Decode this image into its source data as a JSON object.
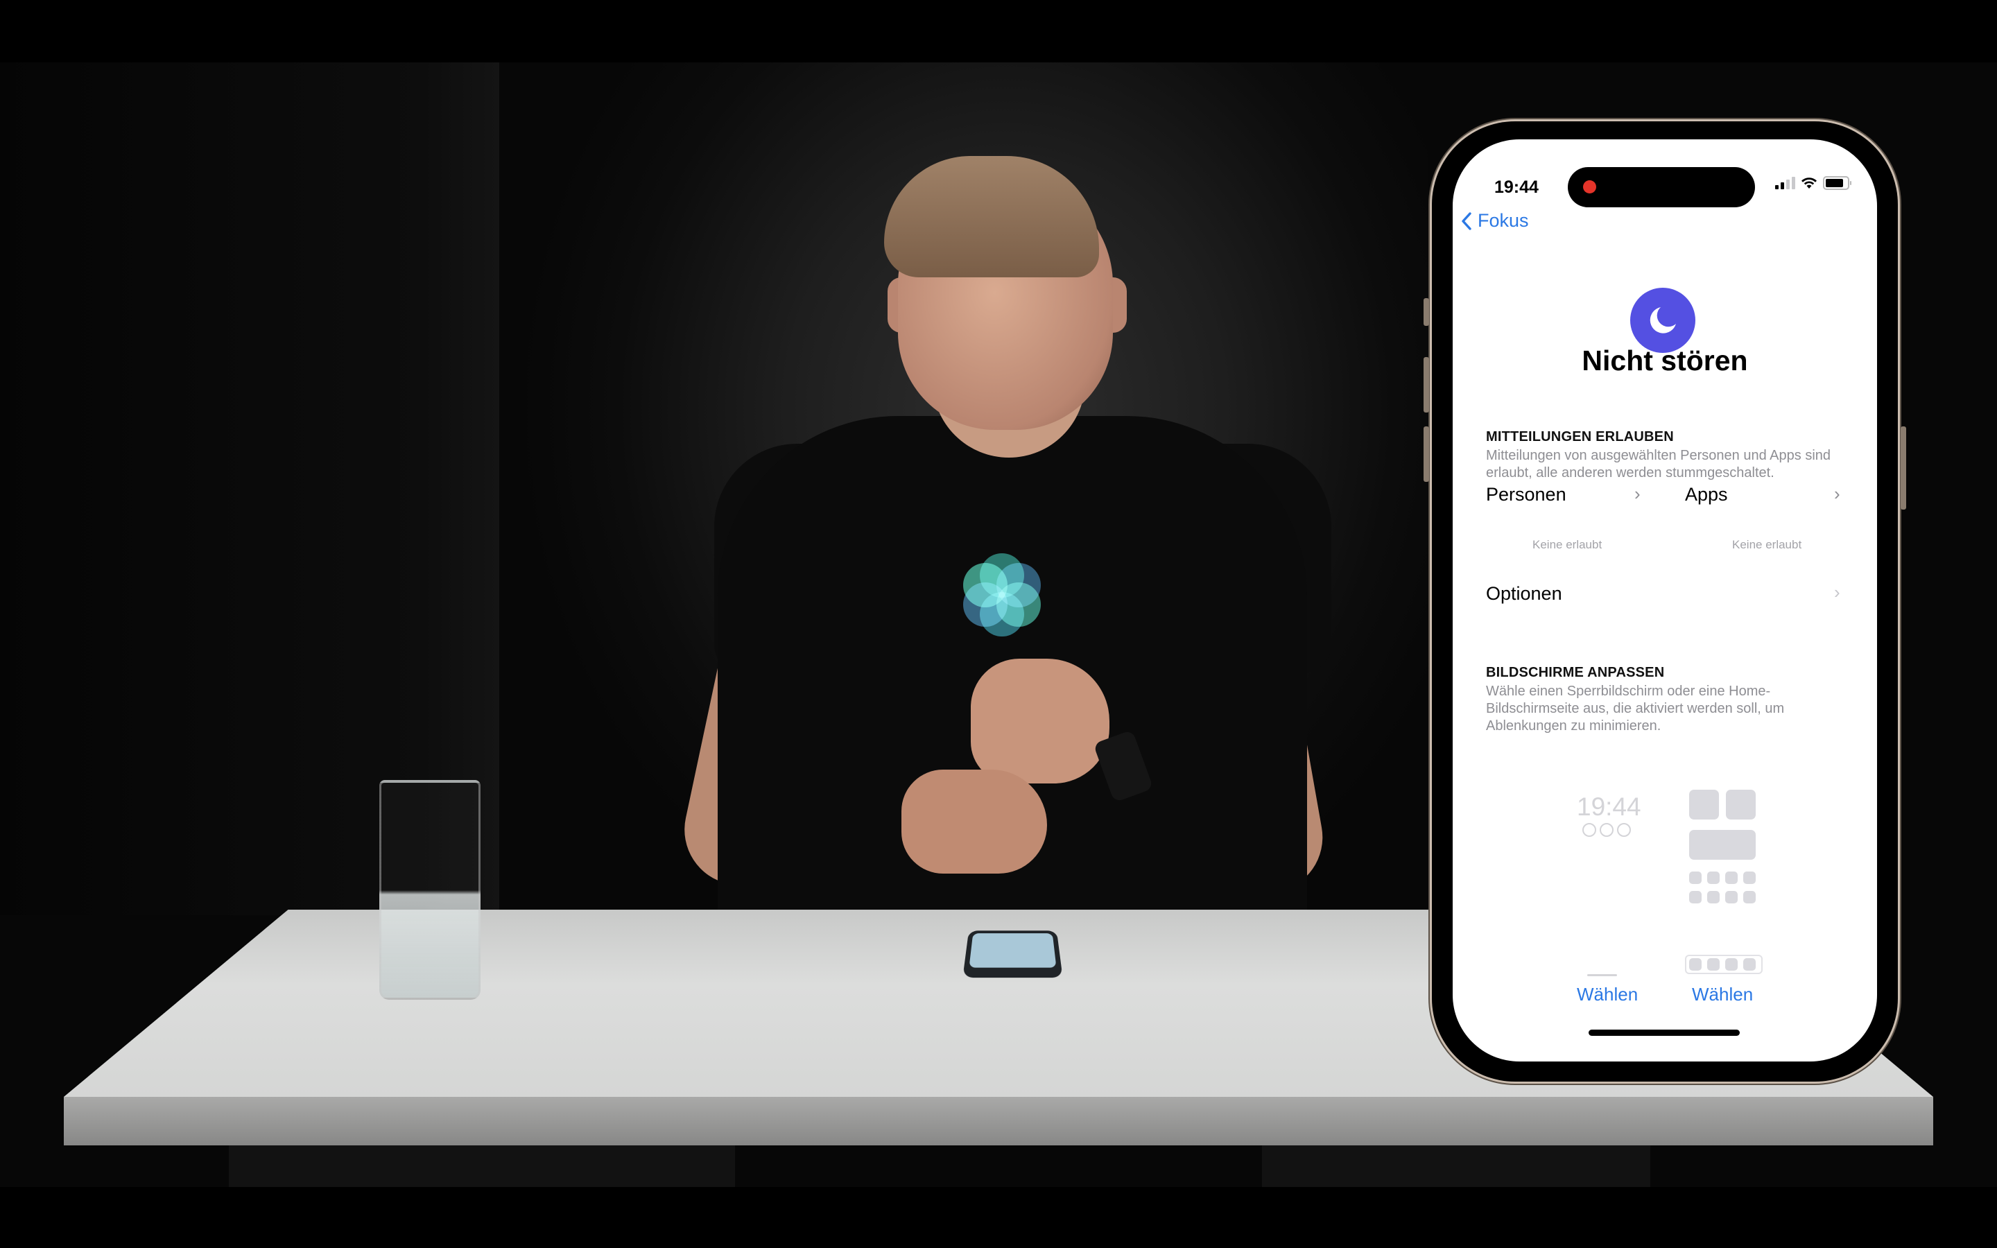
{
  "scene": {
    "description": "Presenter at white table with water glass and smartphone; iPhone mockup overlay showing Focus settings",
    "logo_colors": [
      "#3fae9a",
      "#2f8f9e",
      "#3b7fa6",
      "#46c0a6",
      "#2d9a8c",
      "#35739a"
    ]
  },
  "phone": {
    "status_bar": {
      "time": "19:44",
      "recording_indicator": "red-dot",
      "signal_bars_active": 2,
      "signal_bars_total": 4,
      "icons": [
        "cellular-signal-icon",
        "wifi-icon",
        "battery-icon"
      ]
    },
    "nav": {
      "back_label": "Fokus",
      "back_icon": "chevron-left-icon"
    },
    "focus": {
      "icon": "moon-icon",
      "icon_color": "#5450e2",
      "title": "Nicht stören"
    },
    "allow_notifications": {
      "heading": "MITTEILUNGEN ERLAUBEN",
      "description": "Mitteilungen von ausgewählten Personen und Apps sind erlaubt, alle anderen werden stummgeschaltet.",
      "people": {
        "label": "Personen",
        "note": "Keine erlaubt"
      },
      "apps": {
        "label": "Apps",
        "note": "Keine erlaubt"
      }
    },
    "options": {
      "label": "Optionen"
    },
    "customize_screens": {
      "heading": "BILDSCHIRME ANPASSEN",
      "description": "Wähle einen Sperrbildschirm oder eine Home-Bildschirmseite aus, die aktiviert werden soll, um Ablenkungen zu minimieren.",
      "lock_screen_preview_time": "19:44",
      "lock_choose_label": "Wählen",
      "home_choose_label": "Wählen"
    },
    "accent_color": "#2b78e4"
  }
}
